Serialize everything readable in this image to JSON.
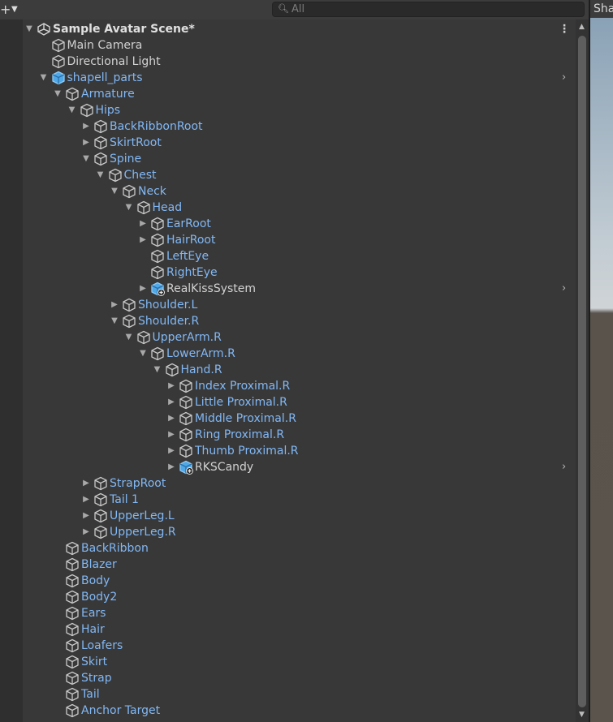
{
  "toolbar": {
    "add_icon": "plus-icon",
    "dropdown_icon": "caret-down-icon"
  },
  "search": {
    "placeholder": "All",
    "icon": "search-icon"
  },
  "scene_view": {
    "tab_label": "Sha"
  },
  "hierarchy": [
    {
      "label": "Sample Avatar Scene*",
      "depth": 0,
      "fold": "open",
      "icon": "unity-scene",
      "style": "bold",
      "menu": true
    },
    {
      "label": "Main Camera",
      "depth": 1,
      "fold": "none",
      "icon": "cube-outline",
      "style": "normal"
    },
    {
      "label": "Directional Light",
      "depth": 1,
      "fold": "none",
      "icon": "cube-outline",
      "style": "normal"
    },
    {
      "label": "shapell_parts",
      "depth": 1,
      "fold": "open",
      "icon": "prefab",
      "style": "blue",
      "chevron": true
    },
    {
      "label": "Armature",
      "depth": 2,
      "fold": "open",
      "icon": "cube-outline",
      "style": "blue"
    },
    {
      "label": "Hips",
      "depth": 3,
      "fold": "open",
      "icon": "cube-outline",
      "style": "blue"
    },
    {
      "label": "BackRibbonRoot",
      "depth": 4,
      "fold": "closed",
      "icon": "cube-outline",
      "style": "blue"
    },
    {
      "label": "SkirtRoot",
      "depth": 4,
      "fold": "closed",
      "icon": "cube-outline",
      "style": "blue"
    },
    {
      "label": "Spine",
      "depth": 4,
      "fold": "open",
      "icon": "cube-outline",
      "style": "blue"
    },
    {
      "label": "Chest",
      "depth": 5,
      "fold": "open",
      "icon": "cube-outline",
      "style": "blue"
    },
    {
      "label": "Neck",
      "depth": 6,
      "fold": "open",
      "icon": "cube-outline",
      "style": "blue"
    },
    {
      "label": "Head",
      "depth": 7,
      "fold": "open",
      "icon": "cube-outline",
      "style": "blue"
    },
    {
      "label": "EarRoot",
      "depth": 8,
      "fold": "closed",
      "icon": "cube-outline",
      "style": "blue"
    },
    {
      "label": "HairRoot",
      "depth": 8,
      "fold": "closed",
      "icon": "cube-outline",
      "style": "blue"
    },
    {
      "label": "LeftEye",
      "depth": 8,
      "fold": "none",
      "icon": "cube-outline",
      "style": "blue"
    },
    {
      "label": "RightEye",
      "depth": 8,
      "fold": "none",
      "icon": "cube-outline",
      "style": "blue"
    },
    {
      "label": "RealKissSystem",
      "depth": 8,
      "fold": "closed",
      "icon": "prefab-added",
      "style": "normal",
      "chevron": true
    },
    {
      "label": "Shoulder.L",
      "depth": 6,
      "fold": "closed",
      "icon": "cube-outline",
      "style": "blue"
    },
    {
      "label": "Shoulder.R",
      "depth": 6,
      "fold": "open",
      "icon": "cube-outline",
      "style": "blue"
    },
    {
      "label": "UpperArm.R",
      "depth": 7,
      "fold": "open",
      "icon": "cube-outline",
      "style": "blue"
    },
    {
      "label": "LowerArm.R",
      "depth": 8,
      "fold": "open",
      "icon": "cube-outline",
      "style": "blue"
    },
    {
      "label": "Hand.R",
      "depth": 9,
      "fold": "open",
      "icon": "cube-outline",
      "style": "blue"
    },
    {
      "label": "Index Proximal.R",
      "depth": 10,
      "fold": "closed",
      "icon": "cube-outline",
      "style": "blue"
    },
    {
      "label": "Little Proximal.R",
      "depth": 10,
      "fold": "closed",
      "icon": "cube-outline",
      "style": "blue"
    },
    {
      "label": "Middle Proximal.R",
      "depth": 10,
      "fold": "closed",
      "icon": "cube-outline",
      "style": "blue"
    },
    {
      "label": "Ring Proximal.R",
      "depth": 10,
      "fold": "closed",
      "icon": "cube-outline",
      "style": "blue"
    },
    {
      "label": "Thumb Proximal.R",
      "depth": 10,
      "fold": "closed",
      "icon": "cube-outline",
      "style": "blue"
    },
    {
      "label": "RKSCandy",
      "depth": 10,
      "fold": "closed",
      "icon": "prefab-added",
      "style": "normal",
      "chevron": true
    },
    {
      "label": "StrapRoot",
      "depth": 4,
      "fold": "closed",
      "icon": "cube-outline",
      "style": "blue"
    },
    {
      "label": "Tail 1",
      "depth": 4,
      "fold": "closed",
      "icon": "cube-outline",
      "style": "blue"
    },
    {
      "label": "UpperLeg.L",
      "depth": 4,
      "fold": "closed",
      "icon": "cube-outline",
      "style": "blue"
    },
    {
      "label": "UpperLeg.R",
      "depth": 4,
      "fold": "closed",
      "icon": "cube-outline",
      "style": "blue"
    },
    {
      "label": "BackRibbon",
      "depth": 2,
      "fold": "none",
      "icon": "cube-outline",
      "style": "blue"
    },
    {
      "label": "Blazer",
      "depth": 2,
      "fold": "none",
      "icon": "cube-outline",
      "style": "blue"
    },
    {
      "label": "Body",
      "depth": 2,
      "fold": "none",
      "icon": "cube-outline",
      "style": "blue"
    },
    {
      "label": "Body2",
      "depth": 2,
      "fold": "none",
      "icon": "cube-outline",
      "style": "blue"
    },
    {
      "label": "Ears",
      "depth": 2,
      "fold": "none",
      "icon": "cube-outline",
      "style": "blue"
    },
    {
      "label": "Hair",
      "depth": 2,
      "fold": "none",
      "icon": "cube-outline",
      "style": "blue"
    },
    {
      "label": "Loafers",
      "depth": 2,
      "fold": "none",
      "icon": "cube-outline",
      "style": "blue"
    },
    {
      "label": "Skirt",
      "depth": 2,
      "fold": "none",
      "icon": "cube-outline",
      "style": "blue"
    },
    {
      "label": "Strap",
      "depth": 2,
      "fold": "none",
      "icon": "cube-outline",
      "style": "blue"
    },
    {
      "label": "Tail",
      "depth": 2,
      "fold": "none",
      "icon": "cube-outline",
      "style": "blue"
    },
    {
      "label": "Anchor Target",
      "depth": 2,
      "fold": "none",
      "icon": "cube-outline",
      "style": "blue"
    }
  ],
  "colors": {
    "blue_label": "#82b8f5",
    "prefab_blue": "#4fa8e8",
    "background": "#383838"
  }
}
